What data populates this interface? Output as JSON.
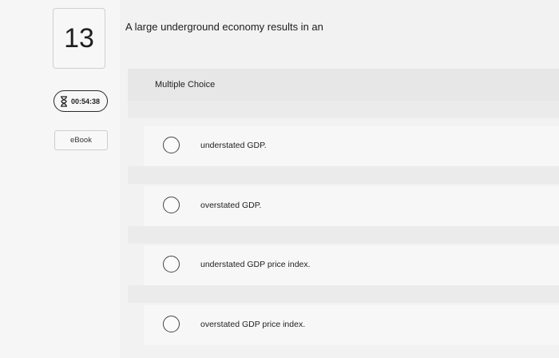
{
  "question": {
    "number": "13",
    "text": "A large underground economy results in an",
    "type_label": "Multiple Choice"
  },
  "timer": {
    "icon": "hourglass-icon",
    "value": "00:54:38"
  },
  "ebook": {
    "label": "eBook"
  },
  "options": [
    {
      "label": "understated GDP."
    },
    {
      "label": "overstated GDP."
    },
    {
      "label": "understated GDP price index."
    },
    {
      "label": "overstated GDP price index."
    }
  ]
}
